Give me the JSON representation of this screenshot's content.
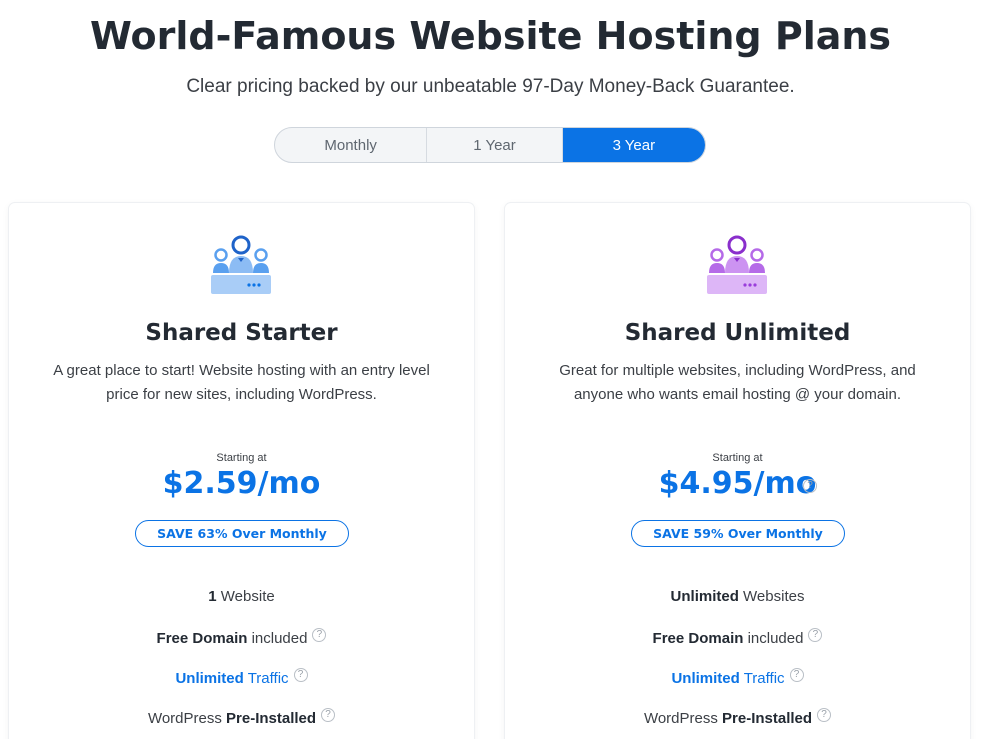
{
  "header": {
    "title": "World-Famous Website Hosting Plans",
    "subtitle": "Clear pricing backed by our unbeatable 97-Day Money-Back Guarantee."
  },
  "term_toggle": {
    "options": [
      "Monthly",
      "1 Year",
      "3 Year"
    ],
    "selected": "3 Year"
  },
  "colors": {
    "accent": "#0b73e5",
    "starter_icon": "#5aa0ef",
    "unlimited_icon": "#b56ae8"
  },
  "plans": [
    {
      "icon": "team-users-icon",
      "name": "Shared Starter",
      "description": "A great place to start! Website hosting with an entry level price for new sites, including WordPress.",
      "starting_at": "Starting at",
      "price": "$2.59/mo",
      "save_badge": "SAVE 63% Over Monthly",
      "features": {
        "websites_bold": "1",
        "websites_rest": " Website",
        "domain_bold": "Free Domain",
        "domain_rest": " included",
        "traffic_bold": "Unlimited",
        "traffic_rest": " Traffic",
        "wp_rest": "WordPress ",
        "wp_bold": "Pre-Installed"
      }
    },
    {
      "icon": "team-users-icon",
      "name": "Shared Unlimited",
      "description": "Great for multiple websites, including WordPress, and anyone who wants email hosting @ your domain.",
      "starting_at": "Starting at",
      "price": "$4.95/mo",
      "save_badge": "SAVE 59% Over Monthly",
      "features": {
        "websites_bold": "Unlimited",
        "websites_rest": " Websites",
        "domain_bold": "Free Domain",
        "domain_rest": " included",
        "traffic_bold": "Unlimited",
        "traffic_rest": " Traffic",
        "wp_rest": "WordPress ",
        "wp_bold": "Pre-Installed"
      }
    }
  ]
}
